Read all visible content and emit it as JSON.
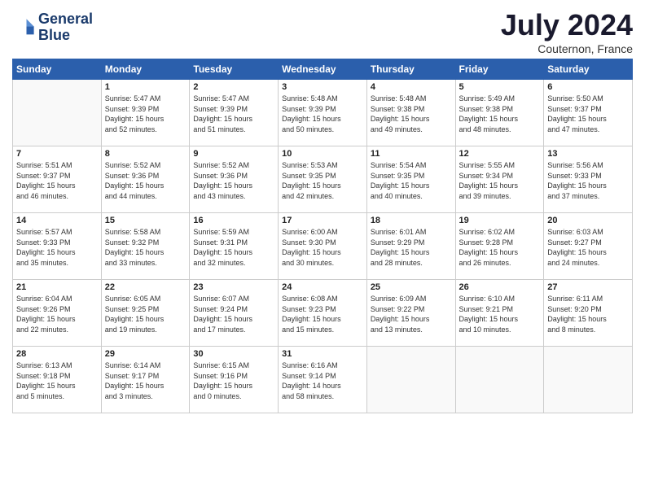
{
  "header": {
    "logo_line1": "General",
    "logo_line2": "Blue",
    "month": "July 2024",
    "location": "Couternon, France"
  },
  "weekdays": [
    "Sunday",
    "Monday",
    "Tuesday",
    "Wednesday",
    "Thursday",
    "Friday",
    "Saturday"
  ],
  "weeks": [
    [
      {
        "day": "",
        "info": ""
      },
      {
        "day": "1",
        "info": "Sunrise: 5:47 AM\nSunset: 9:39 PM\nDaylight: 15 hours\nand 52 minutes."
      },
      {
        "day": "2",
        "info": "Sunrise: 5:47 AM\nSunset: 9:39 PM\nDaylight: 15 hours\nand 51 minutes."
      },
      {
        "day": "3",
        "info": "Sunrise: 5:48 AM\nSunset: 9:39 PM\nDaylight: 15 hours\nand 50 minutes."
      },
      {
        "day": "4",
        "info": "Sunrise: 5:48 AM\nSunset: 9:38 PM\nDaylight: 15 hours\nand 49 minutes."
      },
      {
        "day": "5",
        "info": "Sunrise: 5:49 AM\nSunset: 9:38 PM\nDaylight: 15 hours\nand 48 minutes."
      },
      {
        "day": "6",
        "info": "Sunrise: 5:50 AM\nSunset: 9:37 PM\nDaylight: 15 hours\nand 47 minutes."
      }
    ],
    [
      {
        "day": "7",
        "info": "Sunrise: 5:51 AM\nSunset: 9:37 PM\nDaylight: 15 hours\nand 46 minutes."
      },
      {
        "day": "8",
        "info": "Sunrise: 5:52 AM\nSunset: 9:36 PM\nDaylight: 15 hours\nand 44 minutes."
      },
      {
        "day": "9",
        "info": "Sunrise: 5:52 AM\nSunset: 9:36 PM\nDaylight: 15 hours\nand 43 minutes."
      },
      {
        "day": "10",
        "info": "Sunrise: 5:53 AM\nSunset: 9:35 PM\nDaylight: 15 hours\nand 42 minutes."
      },
      {
        "day": "11",
        "info": "Sunrise: 5:54 AM\nSunset: 9:35 PM\nDaylight: 15 hours\nand 40 minutes."
      },
      {
        "day": "12",
        "info": "Sunrise: 5:55 AM\nSunset: 9:34 PM\nDaylight: 15 hours\nand 39 minutes."
      },
      {
        "day": "13",
        "info": "Sunrise: 5:56 AM\nSunset: 9:33 PM\nDaylight: 15 hours\nand 37 minutes."
      }
    ],
    [
      {
        "day": "14",
        "info": "Sunrise: 5:57 AM\nSunset: 9:33 PM\nDaylight: 15 hours\nand 35 minutes."
      },
      {
        "day": "15",
        "info": "Sunrise: 5:58 AM\nSunset: 9:32 PM\nDaylight: 15 hours\nand 33 minutes."
      },
      {
        "day": "16",
        "info": "Sunrise: 5:59 AM\nSunset: 9:31 PM\nDaylight: 15 hours\nand 32 minutes."
      },
      {
        "day": "17",
        "info": "Sunrise: 6:00 AM\nSunset: 9:30 PM\nDaylight: 15 hours\nand 30 minutes."
      },
      {
        "day": "18",
        "info": "Sunrise: 6:01 AM\nSunset: 9:29 PM\nDaylight: 15 hours\nand 28 minutes."
      },
      {
        "day": "19",
        "info": "Sunrise: 6:02 AM\nSunset: 9:28 PM\nDaylight: 15 hours\nand 26 minutes."
      },
      {
        "day": "20",
        "info": "Sunrise: 6:03 AM\nSunset: 9:27 PM\nDaylight: 15 hours\nand 24 minutes."
      }
    ],
    [
      {
        "day": "21",
        "info": "Sunrise: 6:04 AM\nSunset: 9:26 PM\nDaylight: 15 hours\nand 22 minutes."
      },
      {
        "day": "22",
        "info": "Sunrise: 6:05 AM\nSunset: 9:25 PM\nDaylight: 15 hours\nand 19 minutes."
      },
      {
        "day": "23",
        "info": "Sunrise: 6:07 AM\nSunset: 9:24 PM\nDaylight: 15 hours\nand 17 minutes."
      },
      {
        "day": "24",
        "info": "Sunrise: 6:08 AM\nSunset: 9:23 PM\nDaylight: 15 hours\nand 15 minutes."
      },
      {
        "day": "25",
        "info": "Sunrise: 6:09 AM\nSunset: 9:22 PM\nDaylight: 15 hours\nand 13 minutes."
      },
      {
        "day": "26",
        "info": "Sunrise: 6:10 AM\nSunset: 9:21 PM\nDaylight: 15 hours\nand 10 minutes."
      },
      {
        "day": "27",
        "info": "Sunrise: 6:11 AM\nSunset: 9:20 PM\nDaylight: 15 hours\nand 8 minutes."
      }
    ],
    [
      {
        "day": "28",
        "info": "Sunrise: 6:13 AM\nSunset: 9:18 PM\nDaylight: 15 hours\nand 5 minutes."
      },
      {
        "day": "29",
        "info": "Sunrise: 6:14 AM\nSunset: 9:17 PM\nDaylight: 15 hours\nand 3 minutes."
      },
      {
        "day": "30",
        "info": "Sunrise: 6:15 AM\nSunset: 9:16 PM\nDaylight: 15 hours\nand 0 minutes."
      },
      {
        "day": "31",
        "info": "Sunrise: 6:16 AM\nSunset: 9:14 PM\nDaylight: 14 hours\nand 58 minutes."
      },
      {
        "day": "",
        "info": ""
      },
      {
        "day": "",
        "info": ""
      },
      {
        "day": "",
        "info": ""
      }
    ]
  ]
}
